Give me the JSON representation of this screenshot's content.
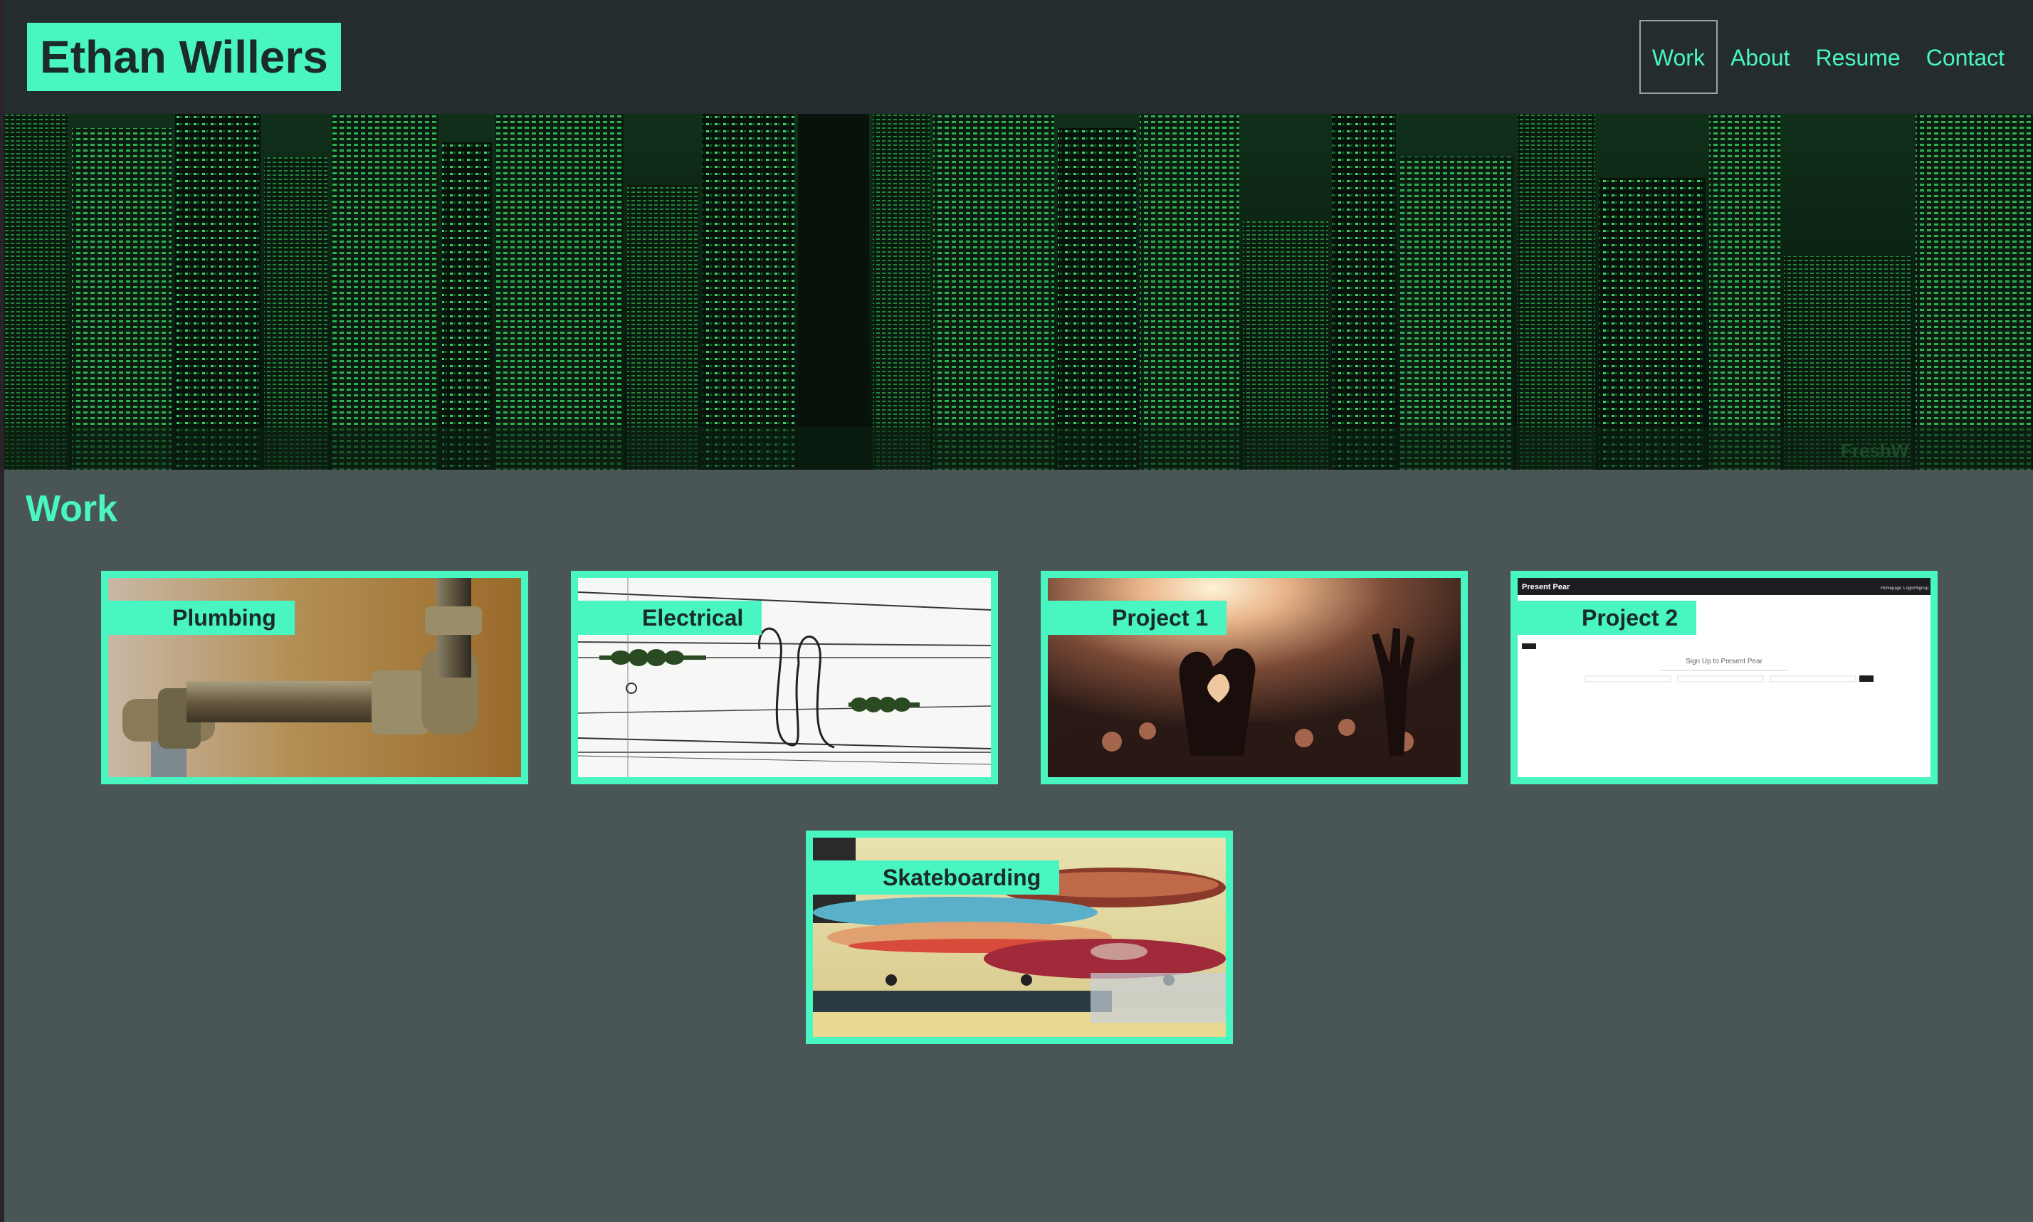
{
  "site": {
    "title": "Ethan Willers"
  },
  "nav": {
    "items": [
      {
        "label": "Work",
        "active": true
      },
      {
        "label": "About",
        "active": false
      },
      {
        "label": "Resume",
        "active": false
      },
      {
        "label": "Contact",
        "active": false
      }
    ]
  },
  "banner": {
    "image": "green-matrix-city-skyline",
    "watermark": "FreshW"
  },
  "work": {
    "heading": "Work",
    "projects": [
      {
        "label": "Plumbing",
        "image": "brass-pipe-fittings"
      },
      {
        "label": "Electrical",
        "image": "power-line-insulators"
      },
      {
        "label": "Project 1",
        "image": "concert-crowd-heart-hands"
      },
      {
        "label": "Project 2",
        "image": "present-pear-signup-screenshot",
        "preview": {
          "app_name": "Present Pear",
          "header_links": [
            "Homepage",
            "Login/Signup"
          ],
          "page_text": "Sign Up to Present Pear"
        }
      },
      {
        "label": "Skateboarding",
        "image": "skateboard-decks"
      }
    ]
  },
  "colors": {
    "accent": "#49f5c0",
    "header_bg": "#242c30",
    "page_bg": "#4a5656",
    "text_dark": "#1b2a2a"
  }
}
